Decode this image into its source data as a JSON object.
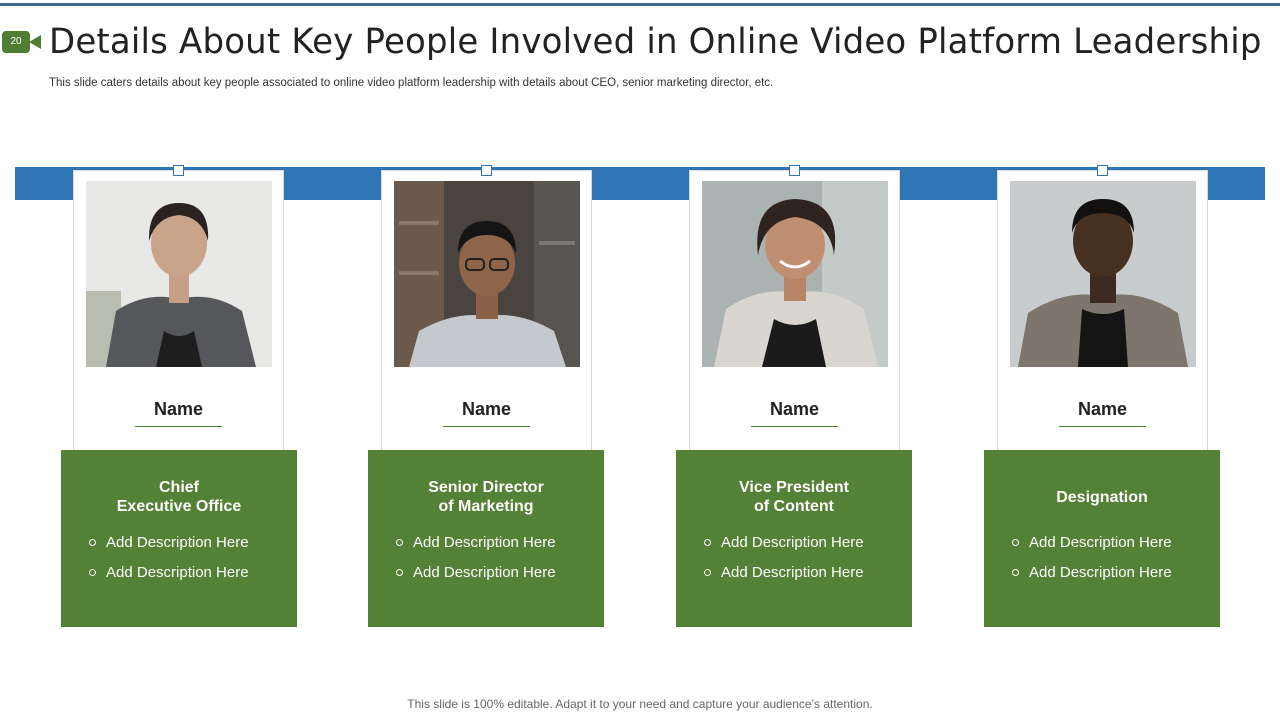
{
  "slide": {
    "number": "20",
    "title": "Details About Key People Involved in Online Video Platform Leadership",
    "subtitle": "This slide caters details about key people associated to online video platform leadership with details about CEO, senior marketing director, etc.",
    "footer": "This slide is 100% editable. Adapt it to your need and capture your audience’s attention."
  },
  "colors": {
    "accent_green": "#538135",
    "band_blue": "#2e75b6"
  },
  "people": [
    {
      "name": "Name",
      "role_line1": "Chief",
      "role_line2": "Executive Office",
      "descriptions": [
        "Add Description Here",
        "Add Description Here"
      ]
    },
    {
      "name": "Name",
      "role_line1": "Senior Director",
      "role_line2": "of Marketing",
      "descriptions": [
        "Add Description Here",
        "Add Description Here"
      ]
    },
    {
      "name": "Name",
      "role_line1": "Vice President",
      "role_line2": "of Content",
      "descriptions": [
        "Add Description Here",
        "Add Description Here"
      ]
    },
    {
      "name": "Name",
      "role_line1": "Designation",
      "role_line2": "",
      "descriptions": [
        "Add Description Here",
        "Add Description Here"
      ]
    }
  ]
}
